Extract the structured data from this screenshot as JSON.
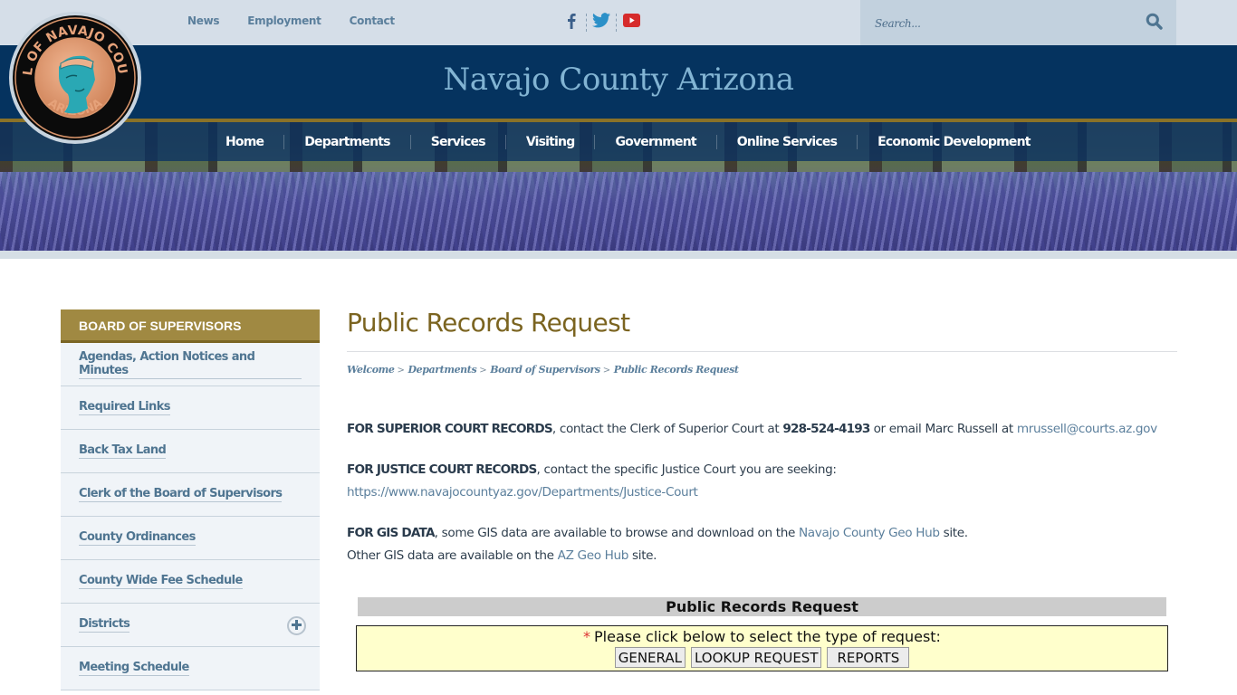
{
  "topbar": {
    "links": [
      "News",
      "Employment",
      "Contact"
    ],
    "social": [
      {
        "icon": "facebook-icon",
        "color": "#3b5f8a"
      },
      {
        "icon": "twitter-icon",
        "color": "#2b90c8"
      },
      {
        "icon": "youtube-icon",
        "color": "#d62b2b"
      }
    ],
    "search": {
      "placeholder": "Search..."
    }
  },
  "logo": {
    "top_text": "SEAL OF NAVAJO COUNTY",
    "bottom_text": "ARIZONA"
  },
  "header": {
    "title": "Navajo County Arizona"
  },
  "nav": {
    "items": [
      "Home",
      "Departments",
      "Services",
      "Visiting",
      "Government",
      "Online Services",
      "Economic Development"
    ]
  },
  "sidebar": {
    "heading": "BOARD OF SUPERVISORS",
    "items": [
      {
        "label": "Agendas, Action Notices and Minutes",
        "expandable": false
      },
      {
        "label": "Required Links",
        "expandable": false
      },
      {
        "label": "Back Tax Land",
        "expandable": false
      },
      {
        "label": "Clerk of the Board of Supervisors",
        "expandable": false
      },
      {
        "label": "County Ordinances",
        "expandable": false
      },
      {
        "label": "County Wide Fee Schedule",
        "expandable": false
      },
      {
        "label": "Districts",
        "expandable": true
      },
      {
        "label": "Meeting Schedule",
        "expandable": false
      }
    ]
  },
  "main": {
    "title": "Public Records Request",
    "breadcrumb": [
      "Welcome",
      "Departments",
      "Board of Supervisors",
      "Public Records Request"
    ],
    "superior": {
      "bold": "FOR SUPERIOR COURT RECORDS",
      "text1": ", contact the Clerk of Superior Court at ",
      "phone": "928-524-4193",
      "text2": " or email Marc Russell at ",
      "email": "mrussell@courts.az.gov"
    },
    "justice": {
      "bold": "FOR JUSTICE COURT RECORDS",
      "text1": ", contact the specific Justice Court you are seeking:",
      "link": "https://www.navajocountyaz.gov/Departments/Justice-Court"
    },
    "gis": {
      "bold": "FOR GIS DATA",
      "text1": ", some GIS data are available to browse and download on the ",
      "link1": "Navajo County Geo Hub",
      "text2": " site.",
      "text3": "Other GIS data are available on the ",
      "link2": "AZ Geo Hub",
      "text4": " site."
    }
  },
  "request_form": {
    "heading": "Public Records Request",
    "required_mark": "*",
    "prompt": "Please click below to select the type of request:",
    "buttons": [
      "GENERAL",
      "LOOKUP REQUEST",
      "REPORTS"
    ]
  }
}
